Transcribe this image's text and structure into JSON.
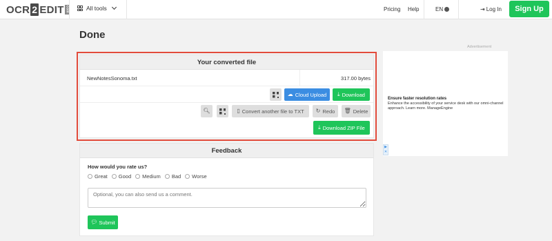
{
  "nav": {
    "logo": {
      "left": "OCR",
      "mid": "2",
      "right": "EDIT",
      "suffix": "com"
    },
    "all_tools": "All tools",
    "pricing": "Pricing",
    "help": "Help",
    "language": "EN",
    "login": "Log In",
    "signup": "Sign Up"
  },
  "page_title": "Done",
  "converted": {
    "heading": "Your converted file",
    "file_name": "NewNotesSonoma.txt",
    "file_size": "317.00 bytes",
    "cloud_upload": "Cloud Upload",
    "download": "Download",
    "convert_another": "Convert another file to TXT",
    "redo": "Redo",
    "delete": "Delete",
    "download_zip": "Download ZIP File"
  },
  "feedback": {
    "heading": "Feedback",
    "question": "How would you rate us?",
    "options": [
      "Great",
      "Good",
      "Medium",
      "Bad",
      "Worse"
    ],
    "comment_placeholder": "Optional, you can also send us a comment.",
    "submit": "Submit"
  },
  "ad": {
    "label": "Advertisement",
    "title": "Ensure faster resolution rates",
    "text": "Enhance the accessibility of your service desk with our omni-channel approach. Learn more. ManageEngine"
  },
  "colors": {
    "accent_green": "#1fc55a",
    "accent_blue": "#3b8de2",
    "highlight_red": "#e24b3b"
  }
}
